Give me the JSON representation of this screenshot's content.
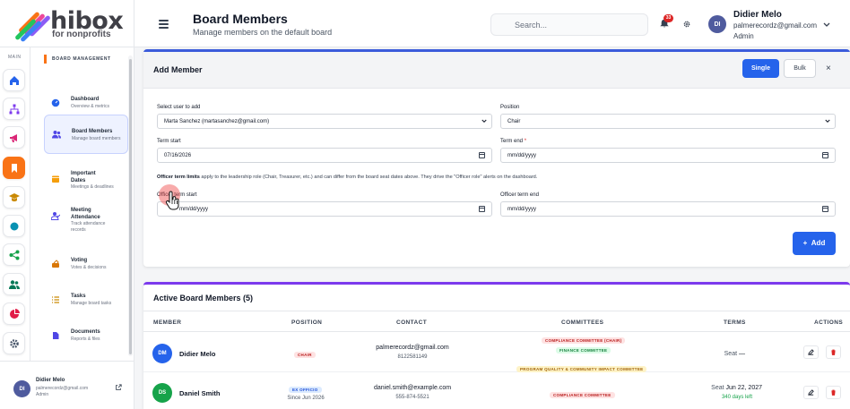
{
  "brand": {
    "name": "hibox",
    "tagline": "for nonprofits"
  },
  "rail": {
    "label": "MAIN",
    "buttons": [
      {
        "icon": "home-icon",
        "color": "#2563eb"
      },
      {
        "icon": "org-chart-icon",
        "color": "#7c3aed"
      },
      {
        "icon": "megaphone-icon",
        "color": "#db2777"
      },
      {
        "icon": "bookmark-icon",
        "color": "#ea580c",
        "active": true
      },
      {
        "icon": "graduation-cap-icon",
        "color": "#ca8a04"
      },
      {
        "icon": "circle-icon",
        "color": "#0891b2"
      },
      {
        "icon": "share-nodes-icon",
        "color": "#16a34a"
      },
      {
        "icon": "users-icon",
        "color": "#047857"
      },
      {
        "icon": "pie-chart-icon",
        "color": "#e11d48"
      },
      {
        "icon": "gear-icon",
        "color": "#475569"
      }
    ]
  },
  "menu": {
    "heading": "BOARD MANAGEMENT",
    "items": [
      {
        "title": "Dashboard",
        "sub": "Overview & metrics",
        "icon": "dashboard-icon",
        "icon_color": "#2563eb"
      },
      {
        "title": "Board Members",
        "sub": "Manage board members",
        "icon": "users-icon",
        "icon_color": "#4f46e5",
        "active": true
      },
      {
        "title": "Important Dates",
        "sub": "Meetings & deadlines",
        "icon": "calendar-icon",
        "icon_color": "#f59e0b"
      },
      {
        "title": "Meeting Attendance",
        "sub": "Track attendance records",
        "icon": "user-check-icon",
        "icon_color": "#4f46e5"
      },
      {
        "title": "Voting",
        "sub": "Votes & decisions",
        "icon": "ballot-icon",
        "icon_color": "#d97706"
      },
      {
        "title": "Tasks",
        "sub": "Manage board tasks",
        "icon": "list-icon",
        "icon_color": "#ca8a04"
      },
      {
        "title": "Documents",
        "sub": "Reports & files",
        "icon": "file-icon",
        "icon_color": "#4f46e5"
      }
    ]
  },
  "footer_user": {
    "initials": "DI",
    "name": "Didier Melo",
    "email": "palmerecordz@gmail.com",
    "role": "Admin"
  },
  "header": {
    "title": "Board Members",
    "subtitle": "Manage members on the default board",
    "search_placeholder": "Search...",
    "notifications": "33",
    "user": {
      "initials": "DI",
      "name": "Didier Melo",
      "email": "palmerecordz@gmail.com",
      "role": "Admin"
    }
  },
  "add_member": {
    "title": "Add Member",
    "mode_single": "Single",
    "mode_bulk": "Bulk",
    "close": "×",
    "select_user_label": "Select user to add",
    "select_user_value": "Marta Sanchez (martasanchez@gmail.com)",
    "position_label": "Position",
    "position_value": "Chair",
    "term_start_label": "Term start",
    "term_start_value": "07/16/2026",
    "term_end_label": "Term end",
    "term_end_required": "*",
    "term_end_value": "mm/dd/yyyy",
    "note_bold": "Officer term limits",
    "note_text": " apply to the leadership role (Chair, Treasurer, etc.) and can differ from the board seat dates above. They drive the \"Officer role\" alerts on the dashboard.",
    "officer_start_label": "Officer term start",
    "officer_start_value": "mm/dd/yyyy",
    "officer_end_label": "Officer term end",
    "officer_end_value": "mm/dd/yyyy",
    "add_button": "Add"
  },
  "members": {
    "title": "Active Board Members (5)",
    "columns": [
      "MEMBER",
      "POSITION",
      "CONTACT",
      "COMMITTEES",
      "TERMS",
      "ACTIONS"
    ],
    "rows": [
      {
        "initials": "DM",
        "avatar_color": "#2563eb",
        "name": "Didier Melo",
        "position": "CHAIR",
        "position_since": "",
        "email": "palmerecordz@gmail.com",
        "phone": "8122581149",
        "committees": [
          {
            "label": "COMPLIANCE COMMITTEE (CHAIR)",
            "style": "red"
          },
          {
            "label": "FINANCE COMMITTEE",
            "style": "green"
          },
          {
            "label": "PROGRAM QUALITY & COMMUNITY IMPACT COMMITTEE",
            "style": "yellow"
          }
        ],
        "terms_prefix": "Seat",
        "terms_value": "—",
        "terms_days": ""
      },
      {
        "initials": "DS",
        "avatar_color": "#16a34a",
        "name": "Daniel Smith",
        "position": "EX OFFICIO",
        "position_since": "Since Jun 2026",
        "email": "daniel.smith@example.com",
        "phone": "555-874-5521",
        "committees": [
          {
            "label": "COMPLIANCE COMMITTEE",
            "style": "red"
          }
        ],
        "terms_prefix": "Seat",
        "terms_value": "Jun 22, 2027",
        "terms_days": "340 days left"
      }
    ]
  }
}
